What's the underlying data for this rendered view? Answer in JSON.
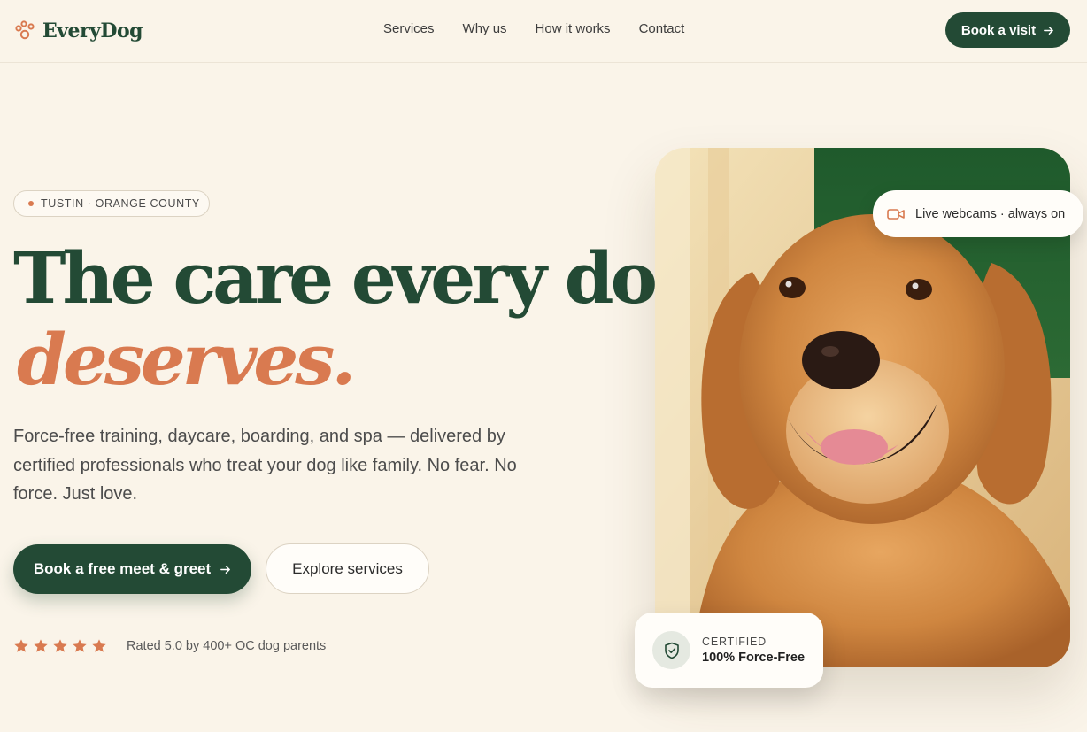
{
  "brand": {
    "name": "EveryDog"
  },
  "nav": {
    "links": [
      "Services",
      "Why us",
      "How it works",
      "Contact"
    ],
    "cta_label": "Book a visit"
  },
  "hero": {
    "location": "TUSTIN · ORANGE COUNTY",
    "headline_line1": "The care every dog",
    "headline_line2": "deserves.",
    "subtext": "Force-free training, daycare, boarding, and spa — delivered by certified professionals who treat your dog like family. No fear. No force. Just love.",
    "primary_cta": "Book a free meet & greet",
    "secondary_cta": "Explore services",
    "rating_stars": 5,
    "rating_text": "Rated 5.0 by 400+ OC dog parents"
  },
  "badges": {
    "webcam": "Live webcams · always on",
    "cert_label": "CERTIFIED",
    "cert_value": "100% Force-Free"
  },
  "colors": {
    "background": "#faf4e9",
    "primary_green": "#234a35",
    "accent_terracotta": "#d97a50"
  },
  "icons": [
    "paw-logo-icon",
    "arrow-right-icon",
    "star-icon",
    "video-camera-icon",
    "shield-check-icon"
  ]
}
